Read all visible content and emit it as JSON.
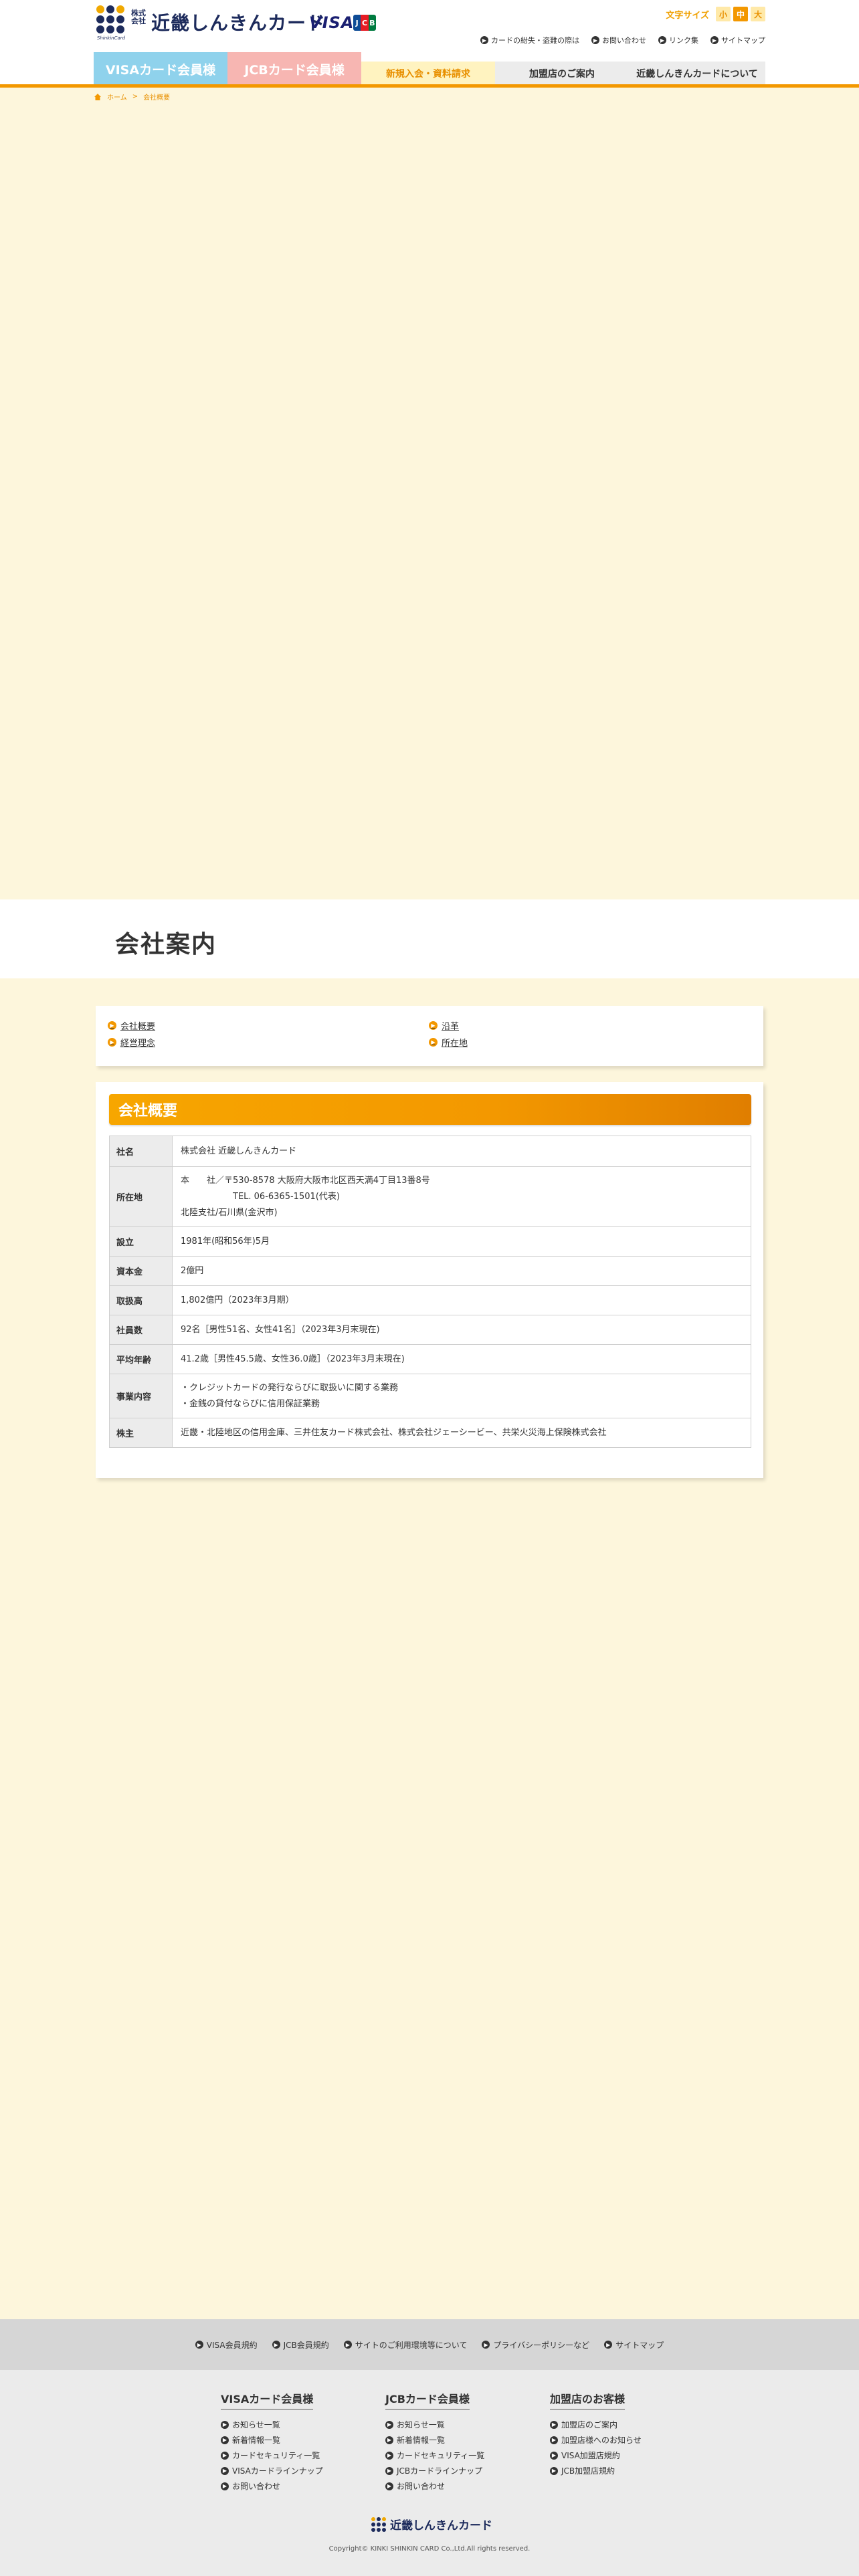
{
  "header": {
    "corp_label": "株式会社",
    "logo_text": "近畿しんきんカード",
    "logo_sub": "ShinkinCard",
    "visa_label": "VISA",
    "jcb_letters": [
      "J",
      "C",
      "B"
    ],
    "fontsize_label": "文字サイズ",
    "fontsize_options": [
      "小",
      "中",
      "大"
    ],
    "utility_links": [
      "カードの紛失・盗難の際は",
      "お問い合わせ",
      "リンク集",
      "サイトマップ"
    ]
  },
  "nav": {
    "visa": "VISAカード会員様",
    "jcb": "JCBカード会員様",
    "new_member": "新規入会・資料請求",
    "merchant": "加盟店のご案内",
    "about": "近畿しんきんカードについて"
  },
  "breadcrumb": [
    "ホーム",
    "会社概要"
  ],
  "page_title": "会社案内",
  "anchors": {
    "company_overview": "会社概要",
    "history": "沿革",
    "philosophy": "経営理念",
    "location": "所在地"
  },
  "company": {
    "section_title": "会社概要",
    "rows": {
      "name": {
        "label": "社名",
        "value": "株式会社 近畿しんきんカード"
      },
      "address": {
        "label": "所在地",
        "line1": "本　　社／〒530-8578 大阪府大阪市北区西天満4丁目13番8号",
        "line2": "TEL. 06-6365-1501(代表)",
        "line3": "北陸支社/石川県(金沢市)"
      },
      "founded": {
        "label": "設立",
        "value": "1981年(昭和56年)5月"
      },
      "capital": {
        "label": "資本金",
        "value": "2億円"
      },
      "volume": {
        "label": "取扱高",
        "value": "1,802億円（2023年3月期）"
      },
      "employees": {
        "label": "社員数",
        "value": "92名［男性51名、女性41名］（2023年3月末現在)"
      },
      "avg_age": {
        "label": "平均年齢",
        "value": "41.2歳［男性45.5歳、女性36.0歳］（2023年3月末現在)"
      },
      "business": {
        "label": "事業内容",
        "line1": "・クレジットカードの発行ならびに取扱いに関する業務",
        "line2": "・金銭の貸付ならびに信用保証業務"
      },
      "shareholders": {
        "label": "株主",
        "value": "近畿・北陸地区の信用金庫、三井住友カード株式会社、株式会社ジェーシービー、共栄火災海上保険株式会社"
      }
    }
  },
  "footer": {
    "links": [
      "VISA会員規約",
      "JCB会員規約",
      "サイトのご利用環境等について",
      "プライバシーポリシーなど",
      "サイトマップ"
    ],
    "columns": [
      {
        "title": "VISAカード会員様",
        "items": [
          "お知らせ一覧",
          "新着情報一覧",
          "カードセキュリティ一覧",
          "VISAカードラインナップ",
          "お問い合わせ"
        ]
      },
      {
        "title": "JCBカード会員様",
        "items": [
          "お知らせ一覧",
          "新着情報一覧",
          "カードセキュリティ一覧",
          "JCBカードラインナップ",
          "お問い合わせ"
        ]
      },
      {
        "title": "加盟店のお客様",
        "items": [
          "加盟店のご案内",
          "加盟店様へのお知らせ",
          "VISA加盟店規約",
          "JCB加盟店規約"
        ]
      }
    ],
    "logo_text": "近畿しんきんカード",
    "copyright": "Copyright© KINKI SHINKIN CARD Co.,Ltd.All rights reserved."
  },
  "colors": {
    "accent": "#f39800",
    "navy": "#1d2b5c",
    "cream": "#fdf6dc",
    "visa_tab": "#8fd2ec",
    "jcb_tab": "#f7b6b2"
  },
  "icons": [
    "home-icon",
    "arrow-right-icon"
  ]
}
